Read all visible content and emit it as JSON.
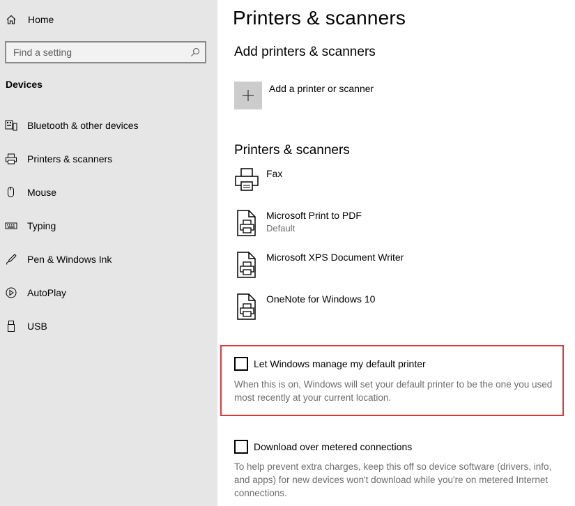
{
  "sidebar": {
    "home_label": "Home",
    "search_placeholder": "Find a setting",
    "section_label": "Devices",
    "items": [
      {
        "label": "Bluetooth & other devices",
        "icon": "bluetooth-devices-icon"
      },
      {
        "label": "Printers & scanners",
        "icon": "printer-icon"
      },
      {
        "label": "Mouse",
        "icon": "mouse-icon"
      },
      {
        "label": "Typing",
        "icon": "keyboard-icon"
      },
      {
        "label": "Pen & Windows Ink",
        "icon": "pen-icon"
      },
      {
        "label": "AutoPlay",
        "icon": "autoplay-icon"
      },
      {
        "label": "USB",
        "icon": "usb-icon"
      }
    ]
  },
  "main": {
    "title": "Printers & scanners",
    "add_section_title": "Add printers & scanners",
    "add_button_label": "Add a printer or scanner",
    "list_section_title": "Printers & scanners",
    "printers": [
      {
        "name": "Fax",
        "status": ""
      },
      {
        "name": "Microsoft Print to PDF",
        "status": "Default"
      },
      {
        "name": "Microsoft XPS Document Writer",
        "status": ""
      },
      {
        "name": "OneNote for Windows 10",
        "status": ""
      }
    ],
    "manage_default": {
      "label": "Let Windows manage my default printer",
      "checked": false,
      "description": "When this is on, Windows will set your default printer to be the one you used most recently at your current location."
    },
    "metered": {
      "label": "Download over metered connections",
      "checked": false,
      "description": "To help prevent extra charges, keep this off so device software (drivers, info, and apps) for new devices won't download while you're on metered Internet connections."
    }
  },
  "colors": {
    "sidebar_bg": "#e6e6e6",
    "highlight_border": "#e0393a",
    "secondary_text": "#6d6d6d"
  }
}
